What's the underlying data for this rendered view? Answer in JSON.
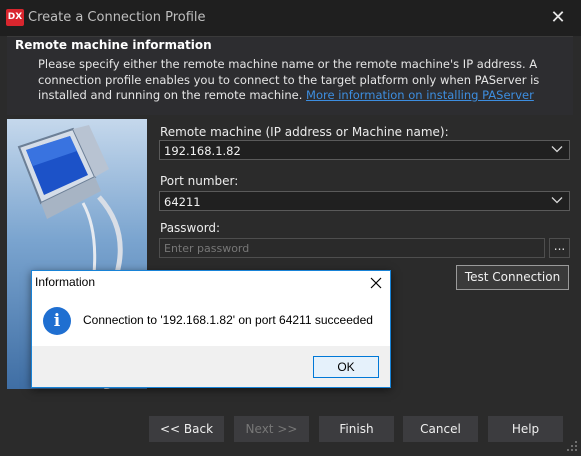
{
  "window": {
    "app_icon_text": "DX",
    "title": "Create a Connection Profile",
    "close_glyph": "✕"
  },
  "header": {
    "title": "Remote machine information",
    "description": "Please specify either the remote machine name or the remote machine's IP address. A connection profile enables you to connect to the target platform only when PAServer is installed and running on the remote machine.",
    "link_text": "More information on installing PAServer"
  },
  "form": {
    "remote_machine_label": "Remote machine (IP address or Machine name):",
    "remote_machine_value": "192.168.1.82",
    "port_label": "Port number:",
    "port_value": "64211",
    "password_label": "Password:",
    "password_placeholder": "Enter password",
    "browse_label": "...",
    "test_button_label": "Test Connection"
  },
  "buttons": {
    "back": "<< Back",
    "next": "Next >>",
    "finish": "Finish",
    "cancel": "Cancel",
    "help": "Help"
  },
  "dialog": {
    "title": "Information",
    "icon": "i",
    "message": "Connection to '192.168.1.82' on port 64211 succeeded",
    "ok": "OK"
  },
  "icons": {
    "app": "dx-app-icon",
    "close": "close-icon",
    "dropdown": "chevron-down-icon",
    "info": "info-icon",
    "wizard_image": "monitor-illustration"
  },
  "colors": {
    "accent": "#1883d7",
    "link": "#3d8ee0",
    "app_icon": "#d9262e",
    "info_icon": "#1f6fd1"
  }
}
